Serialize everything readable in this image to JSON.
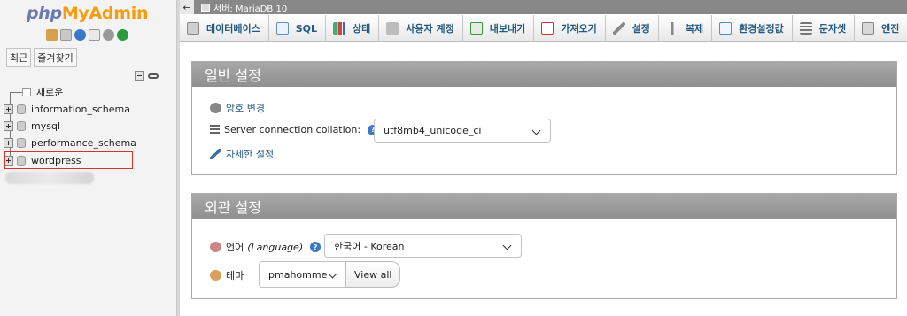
{
  "nav": {
    "logo": {
      "php": "php",
      "my": "My",
      "admin": "Admin"
    },
    "tabs": [
      "최근",
      "즐겨찾기"
    ],
    "tree": {
      "new_label": "새로운",
      "databases": [
        "information_schema",
        "mysql",
        "performance_schema",
        "wordpress"
      ]
    }
  },
  "topbar": {
    "back": "←",
    "server": "서버: MariaDB 10"
  },
  "menu": {
    "tabs": [
      {
        "label": "데이터베이스",
        "icon": "database-icon"
      },
      {
        "label": "SQL",
        "icon": "sql-icon"
      },
      {
        "label": "상태",
        "icon": "status-icon"
      },
      {
        "label": "사용자 계정",
        "icon": "users-icon"
      },
      {
        "label": "내보내기",
        "icon": "export-icon"
      },
      {
        "label": "가져오기",
        "icon": "import-icon"
      },
      {
        "label": "설정",
        "icon": "settings-icon"
      },
      {
        "label": "복제",
        "icon": "replication-icon"
      },
      {
        "label": "환경설정값",
        "icon": "variables-icon"
      },
      {
        "label": "문자셋",
        "icon": "charset-icon"
      },
      {
        "label": "엔진",
        "icon": "engine-icon"
      }
    ]
  },
  "general": {
    "title": "일반 설정",
    "change_password": "암호 변경",
    "collation_label": "Server connection collation:",
    "collation_value": "utf8mb4_unicode_ci",
    "more_settings": "자세한 설정"
  },
  "appearance": {
    "title": "외관 설정",
    "language_label": "언어",
    "language_label_en": "(Language)",
    "language_value": "한국어 - Korean",
    "theme_label": "테마",
    "theme_value": "pmahomme",
    "view_all": "View all"
  },
  "colors": {
    "link": "#235a81",
    "panel_header": "#999999",
    "highlight_border": "#d63232",
    "logo_php": "#6c78af",
    "logo_myadmin": "#f89c0e"
  }
}
